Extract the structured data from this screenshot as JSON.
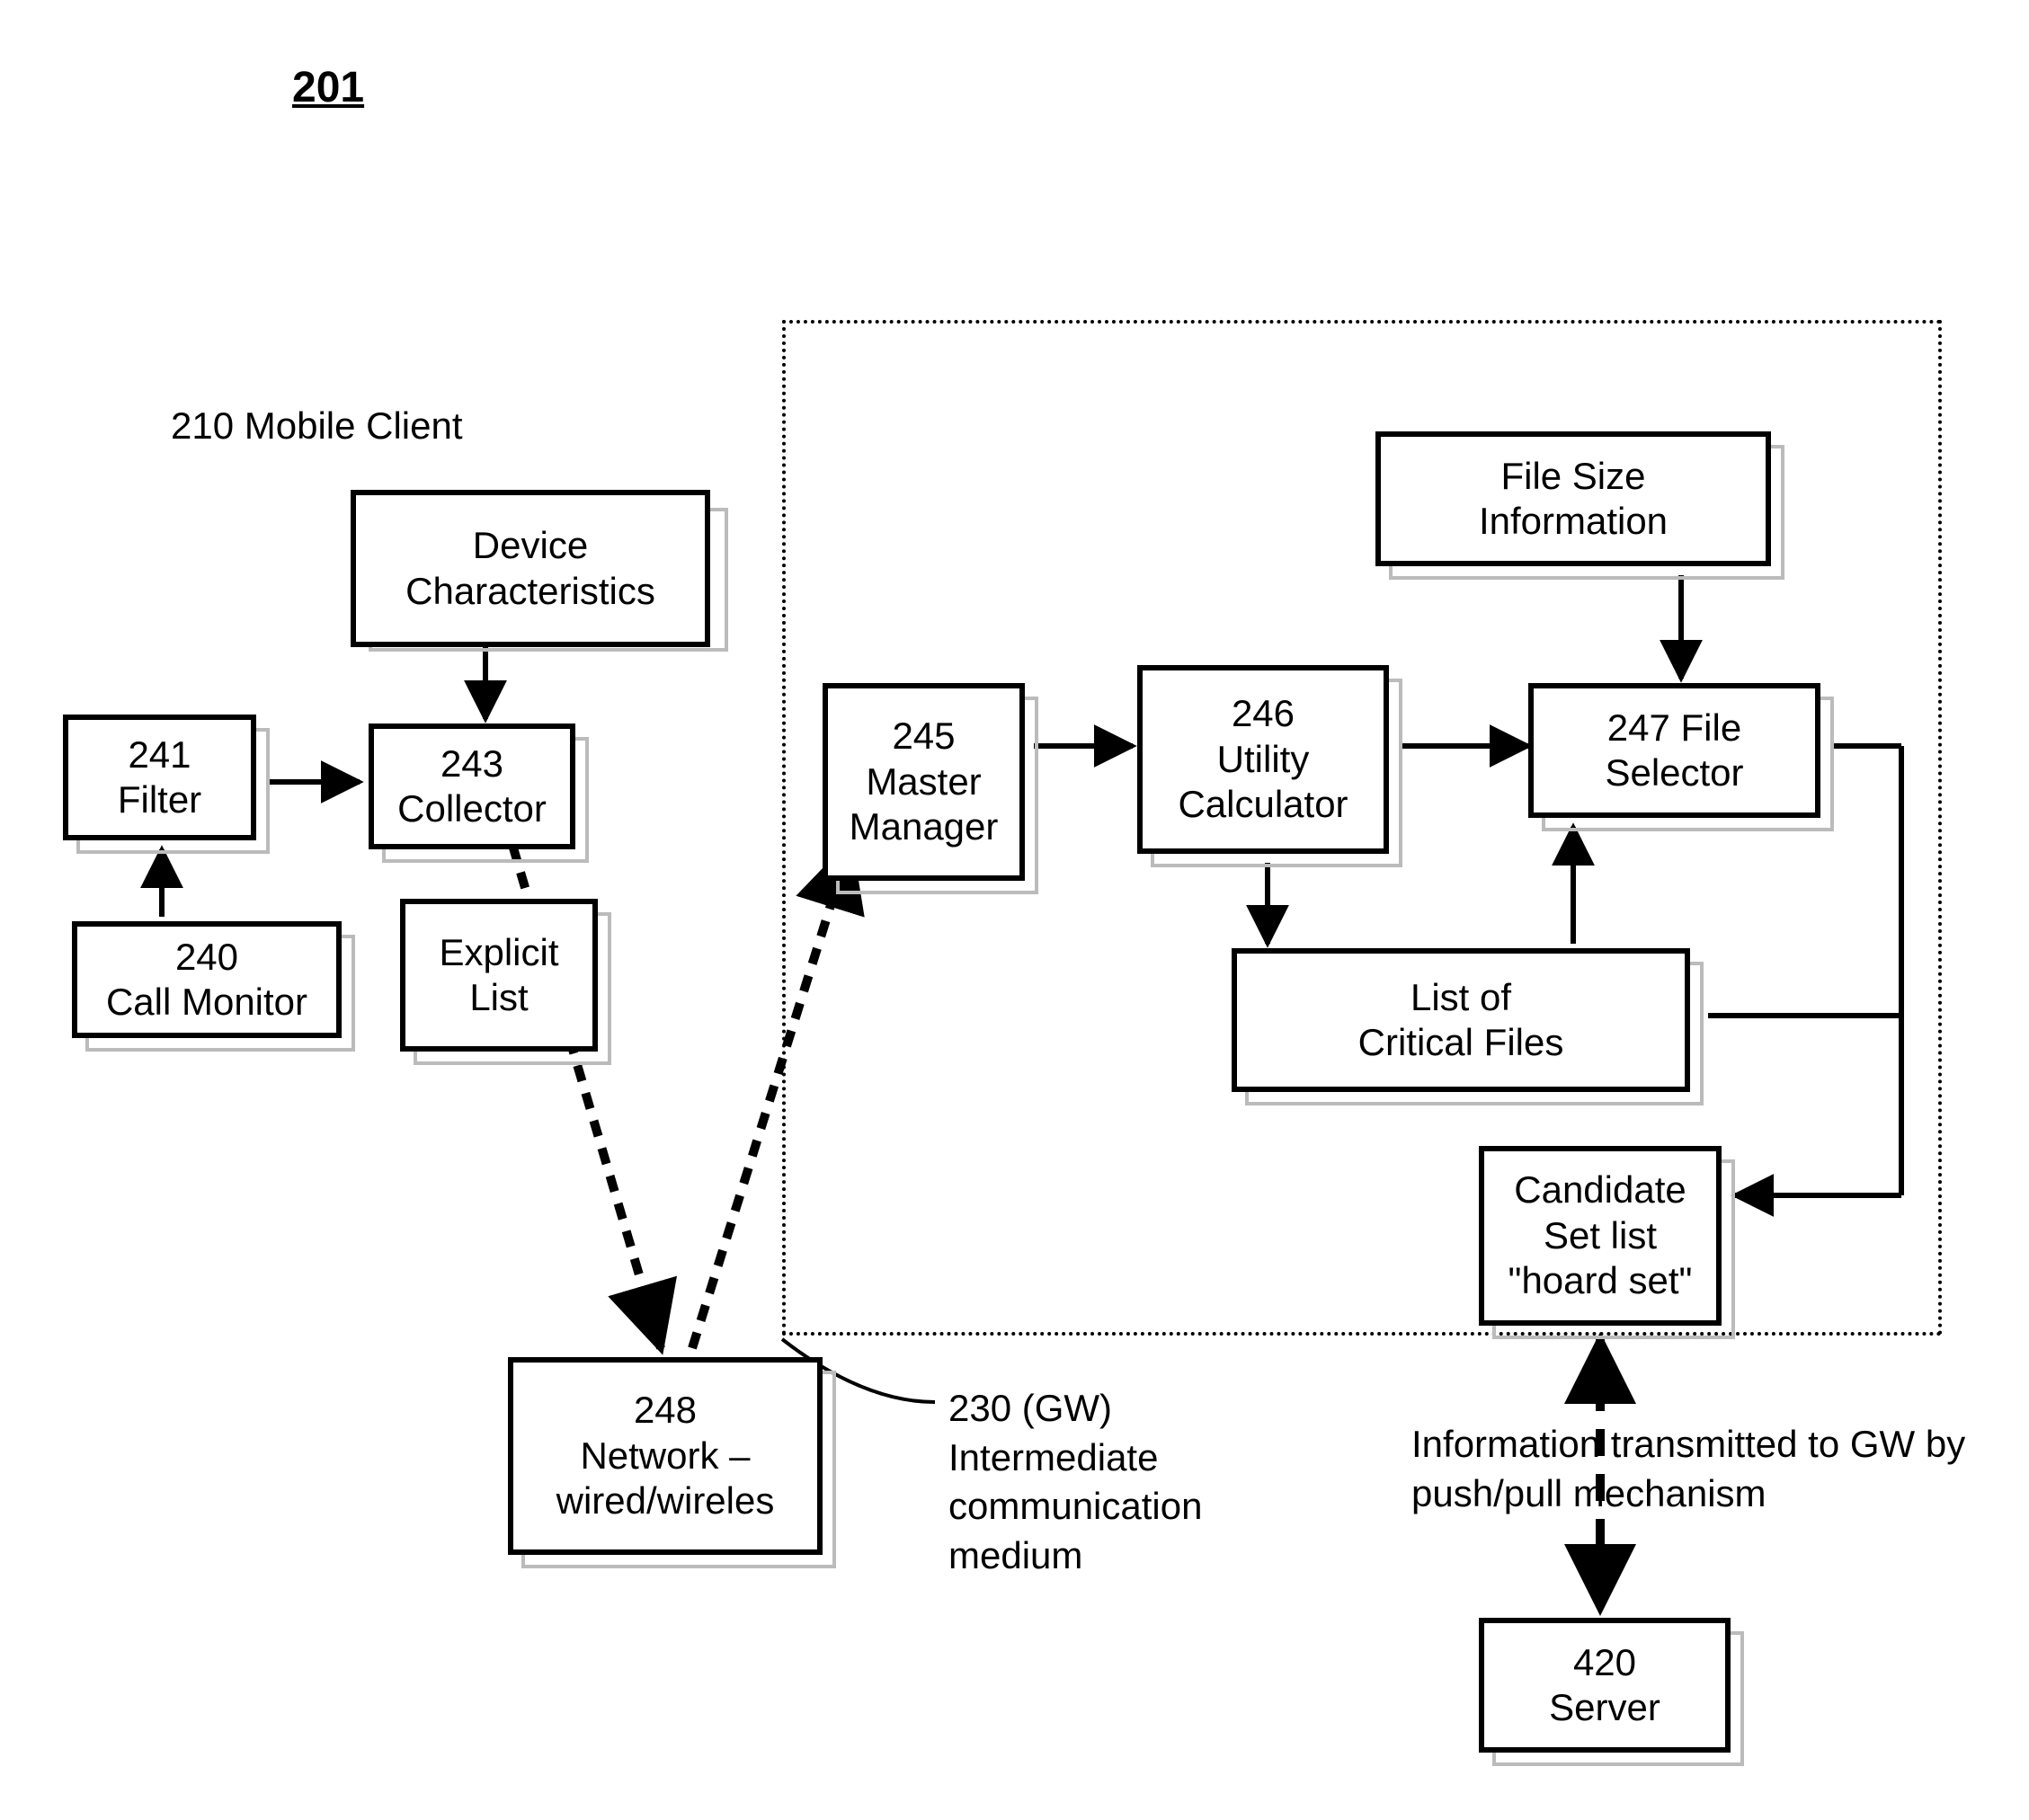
{
  "figure_number": "201",
  "mobile_client_label": "210 Mobile Client",
  "boxes": {
    "device_characteristics": "Device\nCharacteristics",
    "filter": "241\nFilter",
    "collector": "243\nCollector",
    "call_monitor": "240\nCall Monitor",
    "explicit_list": "Explicit\nList",
    "network": "248\nNetwork –\nwired/wireles",
    "master_manager": "245\nMaster\nManager",
    "utility_calculator": "246\nUtility\nCalculator",
    "file_size_info": "File Size\nInformation",
    "file_selector": "247 File\nSelector",
    "critical_files": "List of\nCritical Files",
    "candidate_set": "Candidate\nSet  list\n\"hoard set\"",
    "server": "420\nServer"
  },
  "gw_label": "230  (GW)\nIntermediate\ncommunication\nmedium",
  "info_label": "Information    transmitted to GW by\n                       push/pull mechanism"
}
